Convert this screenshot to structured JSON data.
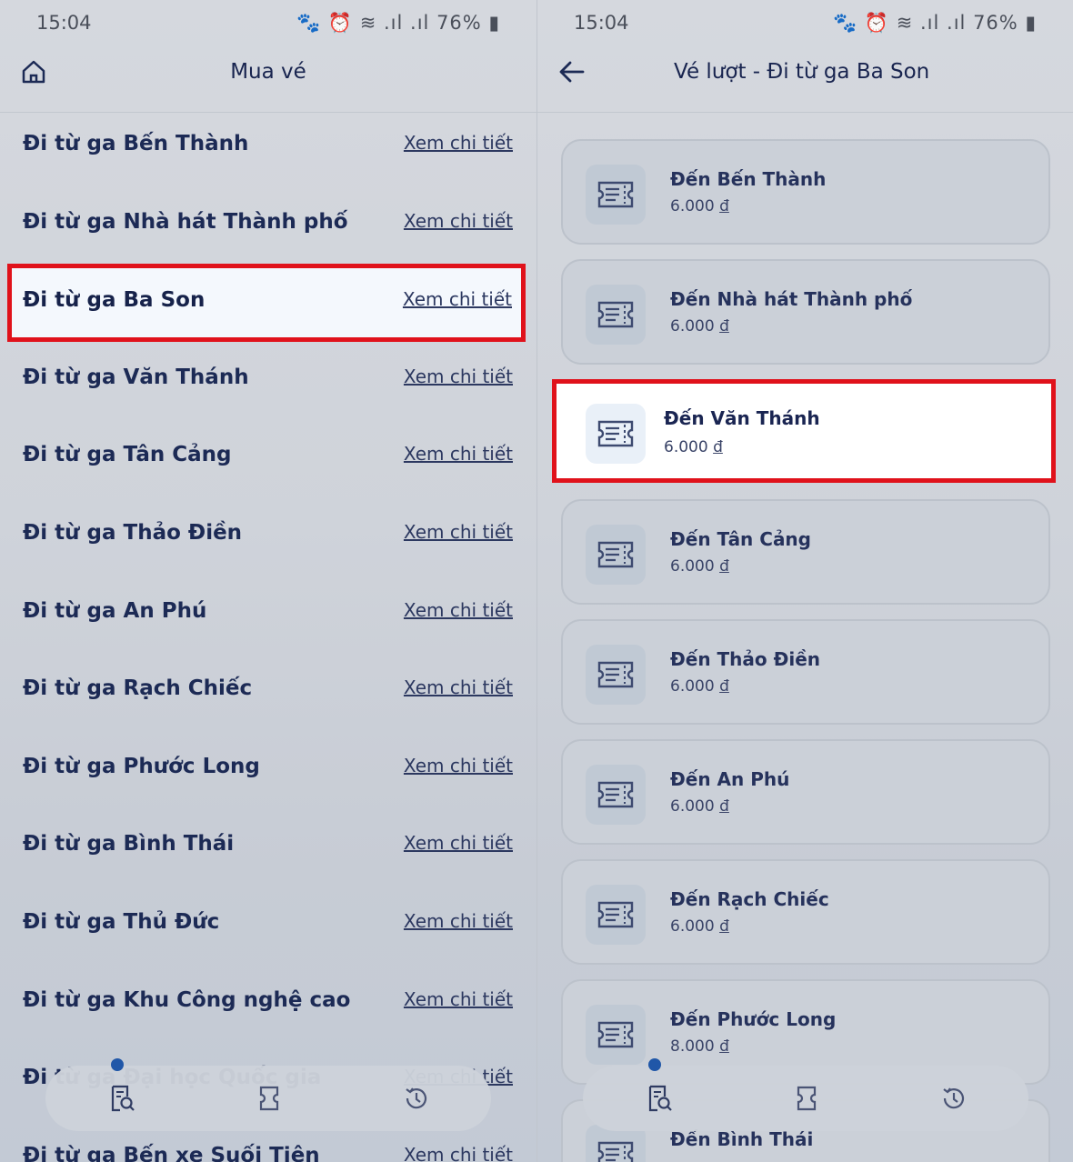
{
  "left_screen": {
    "status": {
      "time": "15:04",
      "indicators": "76%"
    },
    "header": {
      "title": "Mua vé"
    },
    "link_label": "Xem chi tiết",
    "routes": [
      {
        "label": "Đi từ ga Bến Thành"
      },
      {
        "label": "Đi từ ga Nhà hát Thành phố"
      },
      {
        "label": "Đi từ ga Ba Son",
        "selected": true
      },
      {
        "label": "Đi từ ga Văn Thánh"
      },
      {
        "label": "Đi từ ga Tân Cảng"
      },
      {
        "label": "Đi từ ga Thảo Điền"
      },
      {
        "label": "Đi từ ga An Phú"
      },
      {
        "label": "Đi từ ga Rạch Chiếc"
      },
      {
        "label": "Đi từ ga Phước Long"
      },
      {
        "label": "Đi từ ga Bình Thái"
      },
      {
        "label": "Đi từ ga Thủ Đức"
      },
      {
        "label": "Đi từ ga Khu Công nghệ cao"
      },
      {
        "label": "Đi từ ga Đại học Quốc gia"
      },
      {
        "label": "Đi từ ga Bến xe Suối Tiên"
      }
    ]
  },
  "right_screen": {
    "status": {
      "time": "15:04",
      "indicators": "76%"
    },
    "header": {
      "title": "Vé lượt - Đi từ ga Ba Son"
    },
    "currency": "đ",
    "tickets": [
      {
        "destination": "Đến Bến Thành",
        "price": "6.000"
      },
      {
        "destination": "Đến Nhà hát Thành phố",
        "price": "6.000"
      },
      {
        "destination": "Đến Văn Thánh",
        "price": "6.000",
        "selected": true
      },
      {
        "destination": "Đến Tân Cảng",
        "price": "6.000"
      },
      {
        "destination": "Đến Thảo Điền",
        "price": "6.000"
      },
      {
        "destination": "Đến An Phú",
        "price": "6.000"
      },
      {
        "destination": "Đến Rạch Chiếc",
        "price": "6.000"
      },
      {
        "destination": "Đến Phước Long",
        "price": "8.000"
      },
      {
        "destination": "Đến Bình Thái",
        "price": ""
      }
    ]
  },
  "bottom_nav": {
    "items": [
      {
        "icon": "ticket-search-icon",
        "active": true
      },
      {
        "icon": "tickets-icon"
      },
      {
        "icon": "history-icon"
      }
    ]
  },
  "colors": {
    "highlight_border": "#e0121b",
    "text_primary": "#1c2a55",
    "active_dot": "#2057a8"
  }
}
